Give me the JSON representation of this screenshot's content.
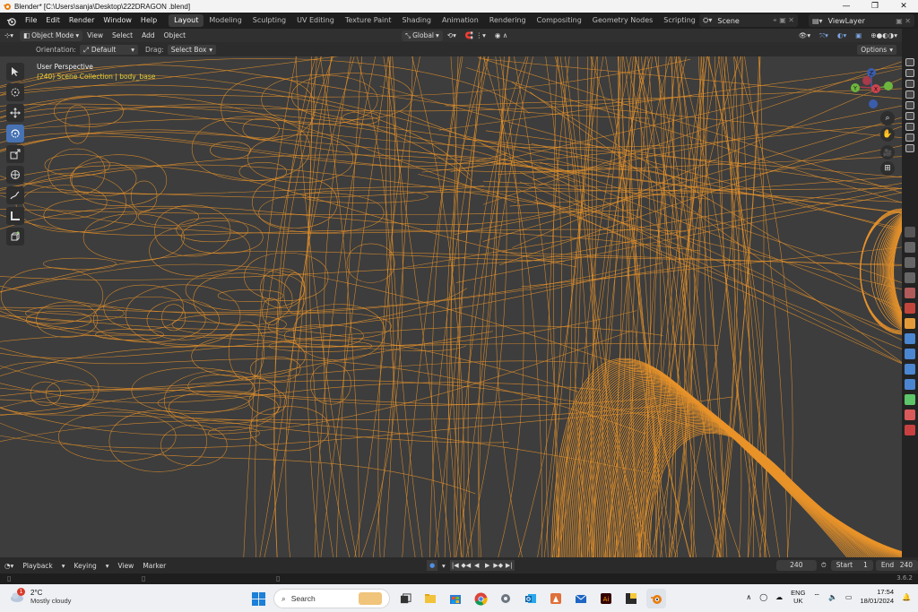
{
  "window": {
    "title": "Blender* [C:\\Users\\sanja\\Desktop\\222DRAGON .blend]",
    "controls": [
      "—",
      "❐",
      "✕"
    ]
  },
  "menus": [
    "File",
    "Edit",
    "Render",
    "Window",
    "Help"
  ],
  "workspaces": [
    "Layout",
    "Modeling",
    "Sculpting",
    "UV Editing",
    "Texture Paint",
    "Shading",
    "Animation",
    "Rendering",
    "Compositing",
    "Geometry Nodes",
    "Scripting"
  ],
  "active_workspace": "Layout",
  "add_tab": "+",
  "scene": {
    "label": "Scene",
    "viewlayer": "ViewLayer"
  },
  "viewport_header": {
    "mode": "Object Mode",
    "menus": [
      "View",
      "Select",
      "Add",
      "Object"
    ],
    "transform": "Global"
  },
  "tool_header": {
    "orientation_label": "Orientation:",
    "orientation_value": "Default",
    "drag_label": "Drag:",
    "drag_value": "Select Box",
    "options": "Options"
  },
  "viewport": {
    "perspective": "User Perspective",
    "collection": "(240) Scene Collection | body_base",
    "wire_color": "#e8932a",
    "bg_color": "#3d3d3d"
  },
  "gizmo": {
    "x": "X",
    "y": "Y",
    "z": "Z"
  },
  "timeline": {
    "menus": [
      "Playback",
      "Keying",
      "View",
      "Marker"
    ],
    "current_frame": "240",
    "start_label": "Start",
    "start_value": "1",
    "end_label": "End",
    "end_value": "240",
    "version": "3.6.2"
  },
  "taskbar": {
    "temperature": "2°C",
    "weather": "Mostly cloudy",
    "notification": "1",
    "search": "Search",
    "lang1": "ENG",
    "lang2": "UK",
    "time": "17:54",
    "date": "18/01/2024"
  }
}
